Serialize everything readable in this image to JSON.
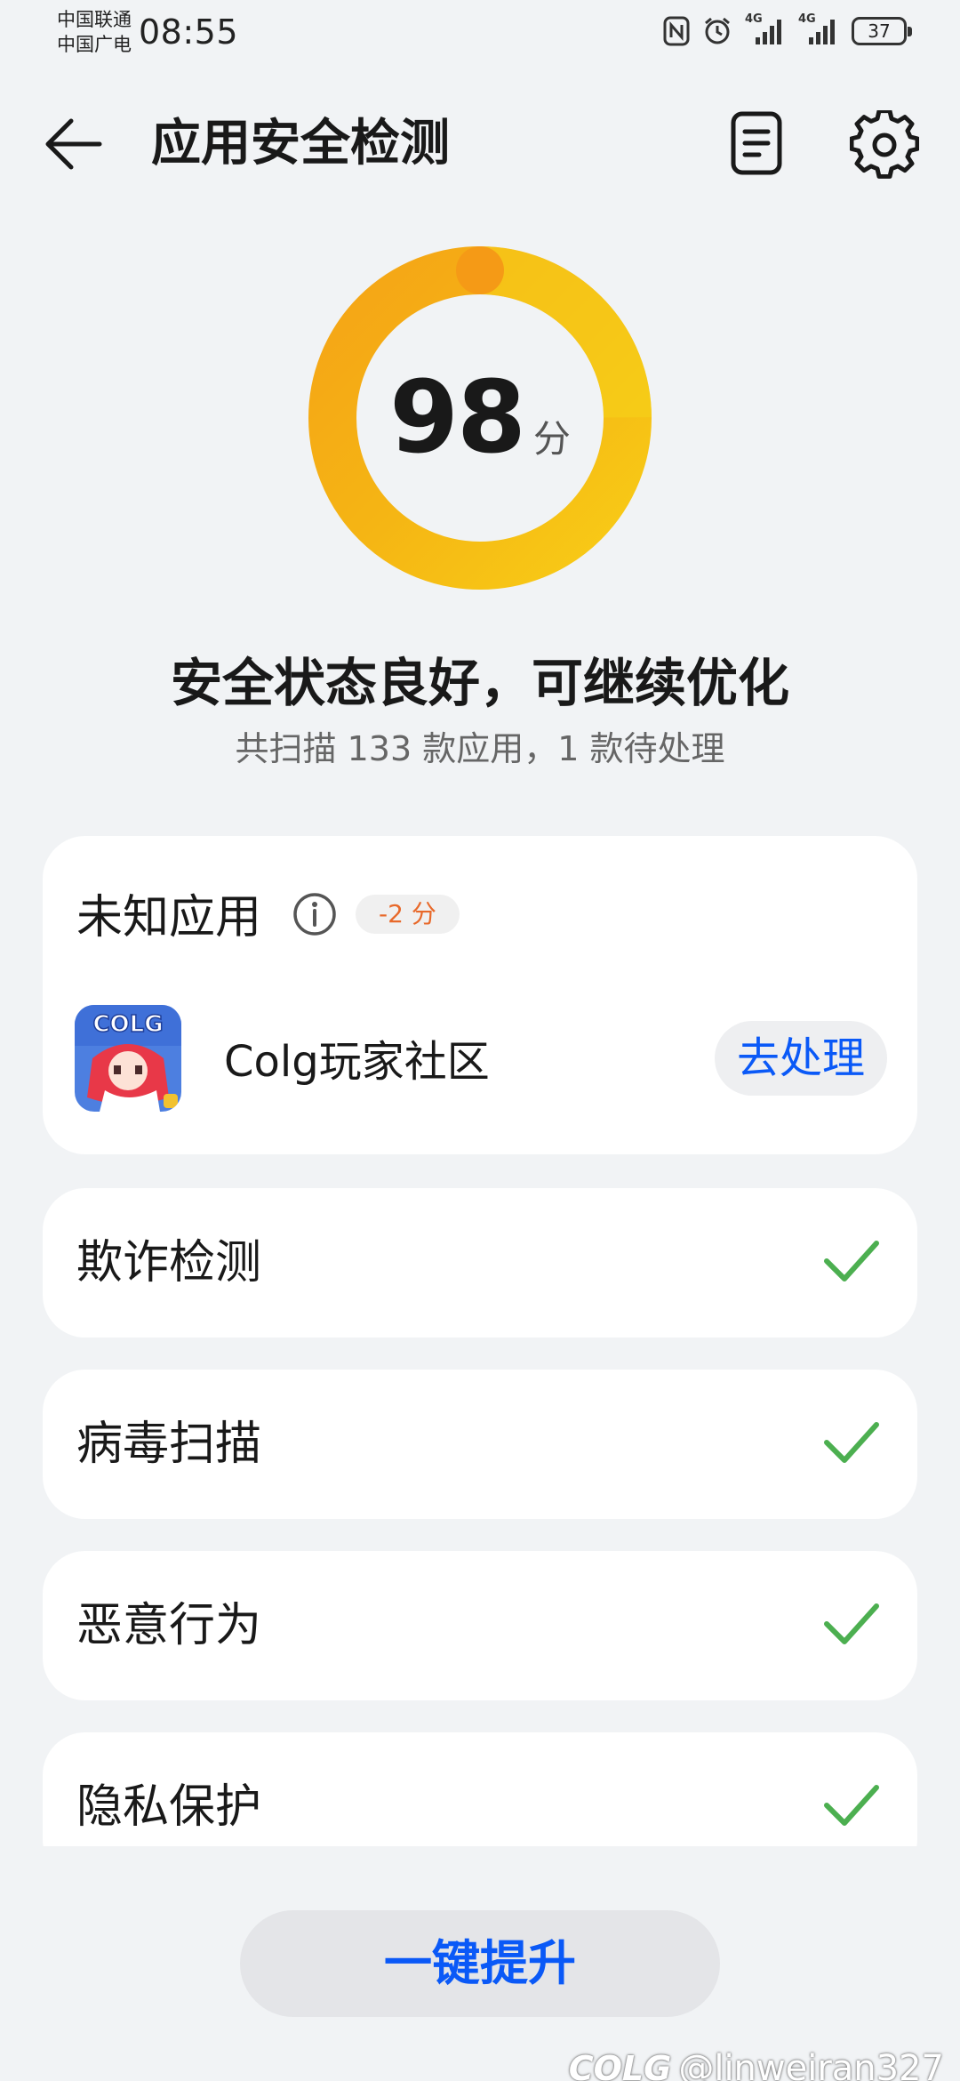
{
  "status_bar": {
    "carrier_1": "中国联通",
    "carrier_2": "中国广电",
    "time": "08:55",
    "network_1": "4G",
    "network_2": "4G",
    "battery": "37"
  },
  "header": {
    "title": "应用安全检测"
  },
  "score": {
    "value": "98",
    "unit": "分",
    "max": 100,
    "ring_colors": [
      "#f5a416",
      "#f8cc16"
    ]
  },
  "summary": {
    "title": "安全状态良好，可继续优化",
    "subtitle": "共扫描 133 款应用，1 款待处理"
  },
  "unknown_apps": {
    "heading": "未知应用",
    "penalty": "-2 分",
    "app_name": "Colg玩家社区",
    "action_label": "去处理",
    "app_icon_text": "COLG"
  },
  "checks": [
    {
      "label": "欺诈检测",
      "status": "passed"
    },
    {
      "label": "病毒扫描",
      "status": "passed"
    },
    {
      "label": "恶意行为",
      "status": "passed"
    },
    {
      "label": "隐私保护",
      "status": "passed"
    }
  ],
  "footer": {
    "button_label": "一键提升"
  },
  "watermark": {
    "logo": "COLG",
    "handle": "@linweiran327"
  },
  "colors": {
    "accent_blue": "#0a59f7",
    "check_green": "#4caf50",
    "penalty_orange": "#e8692a",
    "background": "#f1f3f5"
  }
}
